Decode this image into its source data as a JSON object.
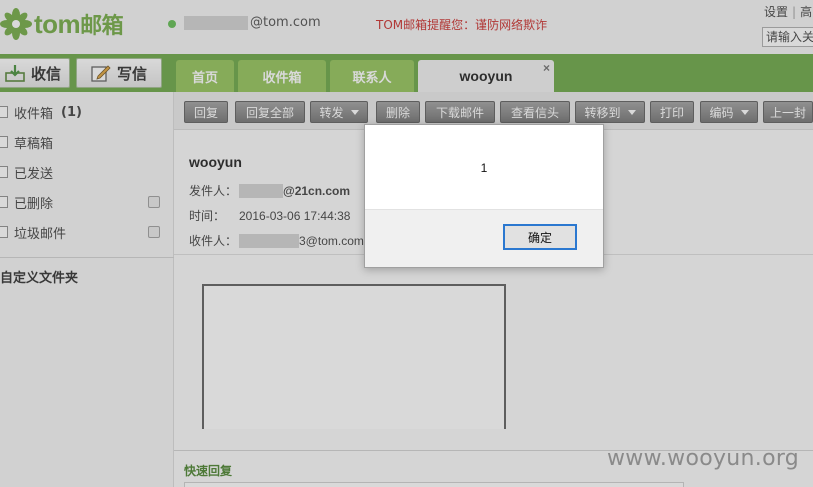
{
  "brand": {
    "logo_text": "tom",
    "logo_cn": "邮箱",
    "accent": "#62a13a"
  },
  "header": {
    "account_suffix": "@tom.com",
    "notice": "TOM邮箱提醒您：谨防网络欺诈",
    "links": [
      "设置",
      "高"
    ],
    "search_placeholder": "请输入关"
  },
  "actions": {
    "receive": "收信",
    "write": "写信"
  },
  "tabs": [
    {
      "label": "首页"
    },
    {
      "label": "收件箱"
    },
    {
      "label": "联系人"
    },
    {
      "label": "wooyun",
      "active": true,
      "close": "×"
    }
  ],
  "sidebar": {
    "folders": [
      {
        "label": "收件箱",
        "count": "(1)"
      },
      {
        "label": "草稿箱"
      },
      {
        "label": "已发送"
      },
      {
        "label": "已删除"
      },
      {
        "label": "垃圾邮件"
      }
    ],
    "custom_folders": "自定义文件夹"
  },
  "toolbar": {
    "buttons": [
      {
        "label": "回复"
      },
      {
        "label": "回复全部"
      },
      {
        "label": "转发",
        "dropdown": true
      },
      {
        "label": "删除"
      },
      {
        "label": "下载邮件"
      },
      {
        "label": "查看信头"
      },
      {
        "label": "转移到",
        "dropdown": true
      },
      {
        "label": "打印"
      },
      {
        "label": "编码",
        "dropdown": true
      },
      {
        "label": "上一封"
      }
    ]
  },
  "mail": {
    "subject": "wooyun",
    "from_label": "发件人：",
    "from_suffix": "@21cn.com",
    "time_label": "时间：",
    "time": "2016-03-06 17:44:38",
    "to_label": "收件人：",
    "to_suffix": "3@tom.com"
  },
  "quick_reply": "快速回复",
  "watermark": "www.wooyun.org",
  "dialog": {
    "message": "1",
    "ok": "确定"
  }
}
